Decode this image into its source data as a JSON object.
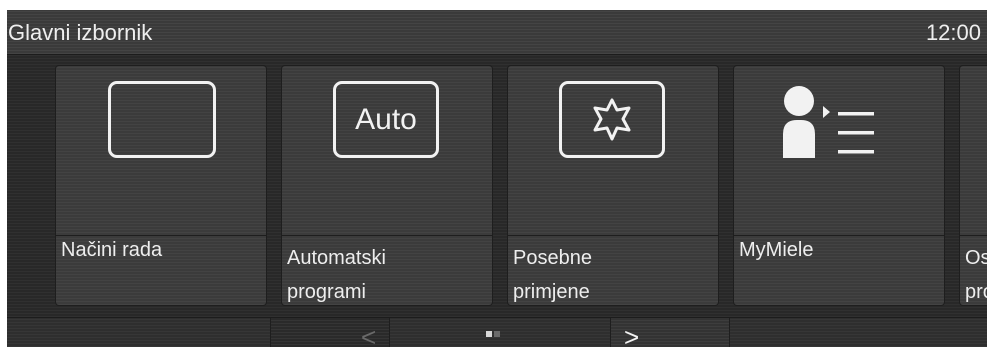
{
  "header": {
    "title": "Glavni izbornik",
    "time": "12:00"
  },
  "tiles": [
    {
      "label_line1": "Načini rada",
      "label_line2": "",
      "icon": "empty-frame-icon"
    },
    {
      "label_line1": "Automatski",
      "label_line2": "programi",
      "icon": "auto-icon",
      "icon_text": "Auto"
    },
    {
      "label_line1": "Posebne",
      "label_line2": "primjene",
      "icon": "star-burst-icon"
    },
    {
      "label_line1": "MyMiele",
      "label_line2": "",
      "icon": "user-list-icon"
    },
    {
      "label_line1": "Os",
      "label_line2": "pro",
      "icon": ""
    }
  ],
  "pager": {
    "prev_label": "<",
    "next_label": ">",
    "pages": 2,
    "current_page": 1
  },
  "colors": {
    "background": "#282828",
    "tile": "#3b3b3b",
    "text": "#eeeeee",
    "icon": "#f2f2f2",
    "dot_active": "#d8d8d8",
    "dot_inactive": "#6a6a6a"
  }
}
